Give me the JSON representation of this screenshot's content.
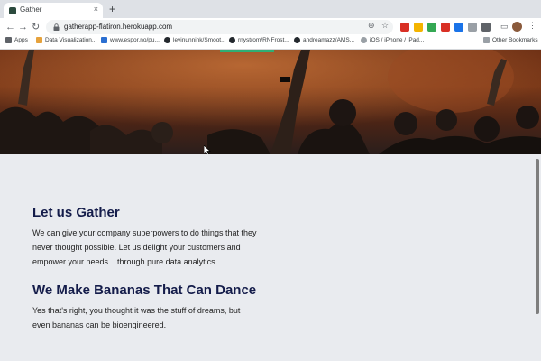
{
  "browser": {
    "tab_title": "Gather",
    "new_tab_label": "+",
    "url": "gatherapp-flatiron.herokuapp.com",
    "bookmarks": [
      {
        "label": "Apps",
        "icon": "apps-grid-icon",
        "color": "#5f6368"
      },
      {
        "label": "Data Visualization...",
        "icon": "chart-icon",
        "color": "#e6a23c"
      },
      {
        "label": "www.espor.no/pu...",
        "icon": "site-icon",
        "color": "#2b6fd1"
      },
      {
        "label": "levinunnink/Smoot...",
        "icon": "github-icon",
        "color": "#24292e"
      },
      {
        "label": "rnystrom/RNFrost...",
        "icon": "github-icon",
        "color": "#24292e"
      },
      {
        "label": "andreamazz/AMS...",
        "icon": "github-icon",
        "color": "#24292e"
      },
      {
        "label": "iOS / iPhone / iPad...",
        "icon": "site-icon",
        "color": "#9aa0a6"
      }
    ],
    "other_bookmarks": "Other Bookmarks",
    "extension_colors": [
      "#d93025",
      "#f4b400",
      "#34a853",
      "#d93025",
      "#1a73e8",
      "#9aa0a6",
      "#5f6368"
    ]
  },
  "page": {
    "section1": {
      "heading": "Let us Gather",
      "body": "We can give your company superpowers to do things that they never thought possible. Let us delight your customers and empower your needs... through pure data analytics."
    },
    "section2": {
      "heading": "We Make Bananas That Can Dance",
      "body": "Yes that's right, you thought it was the stuff of dreams, but even bananas can be bioengineered."
    }
  },
  "colors": {
    "heading": "#141c4a",
    "accent": "#2fae74",
    "page_bg": "#e9ebef"
  }
}
